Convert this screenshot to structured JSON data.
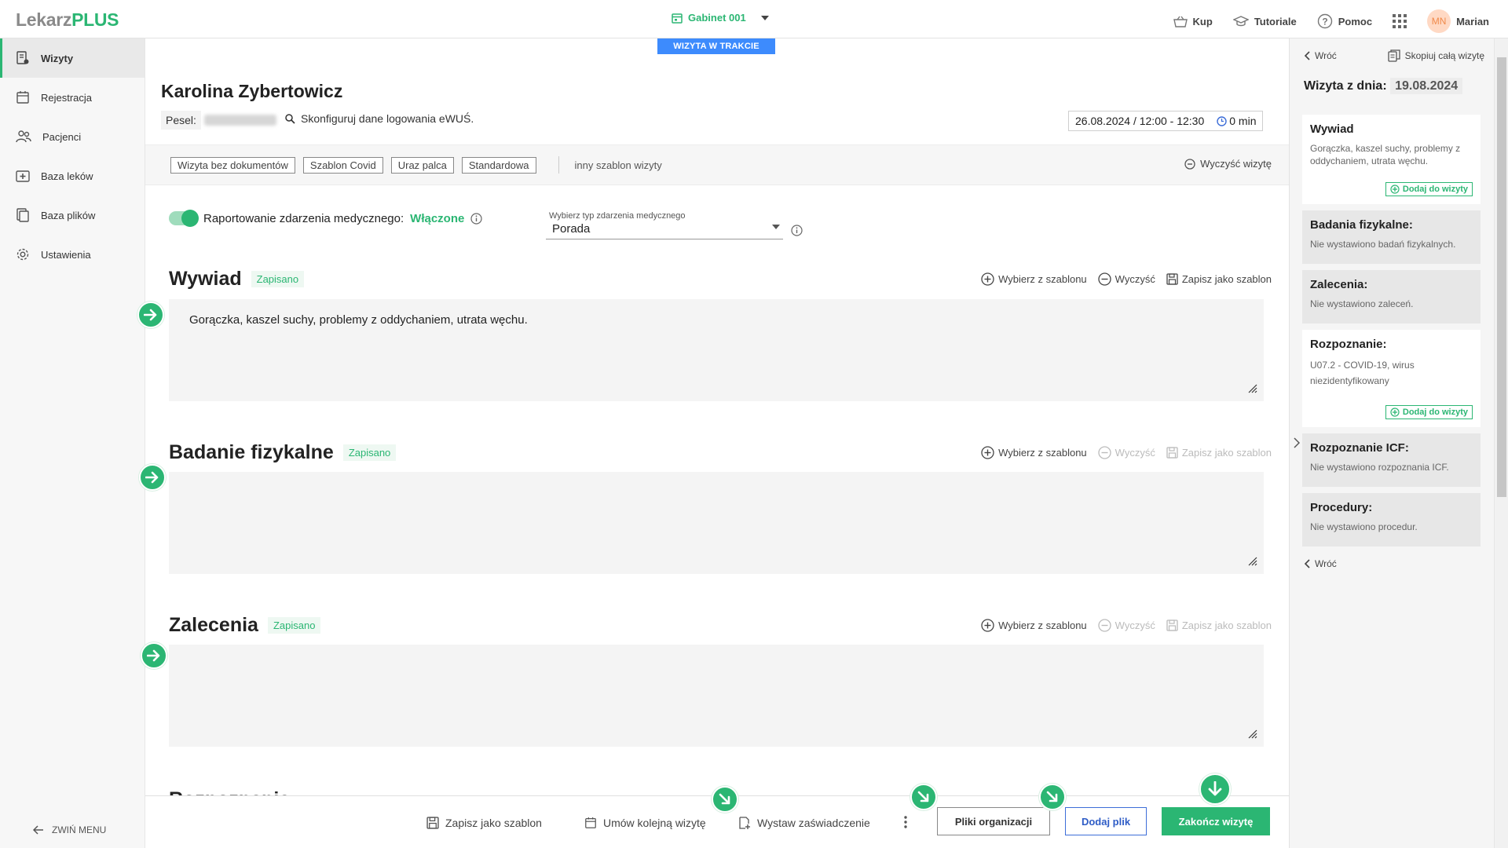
{
  "app": {
    "logo_part1": "Lekarz",
    "logo_part2": "PLUS",
    "cabinet": "Gabinet 001"
  },
  "topnav": {
    "buy": "Kup",
    "tutorials": "Tutoriale",
    "help": "Pomoc",
    "avatar_initials": "MN",
    "user": "Marian"
  },
  "sidebar": {
    "items": [
      {
        "label": "Wizyty",
        "icon": "visits-icon",
        "active": true
      },
      {
        "label": "Rejestracja",
        "icon": "calendar-icon"
      },
      {
        "label": "Pacjenci",
        "icon": "patients-icon"
      },
      {
        "label": "Baza leków",
        "icon": "medkit-icon"
      },
      {
        "label": "Baza plików",
        "icon": "file-icon"
      },
      {
        "label": "Ustawienia",
        "icon": "gear-icon"
      }
    ],
    "collapse": "ZWIŃ MENU"
  },
  "visit": {
    "status_badge": "WIZYTA W TRAKCIE",
    "patient_name": "Karolina Zybertowicz",
    "pesel_label": "Pesel:",
    "ewus_link": "Skonfiguruj dane logowania eWUŚ.",
    "date_range": "26.08.2024 / 12:00 - 12:30",
    "duration": "0 min",
    "templates": [
      "Wizyta bez dokumentów",
      "Szablon Covid",
      "Uraz palca",
      "Standardowa"
    ],
    "other_template": "inny szablon wizyty",
    "clear_visit": "Wyczyść wizytę",
    "reporting_label": "Raportowanie zdarzenia medycznego:",
    "reporting_state": "Włączone",
    "event_type_caption": "Wybierz typ zdarzenia medycznego",
    "event_type_value": "Porada"
  },
  "actions": {
    "from_template": "Wybierz z szablonu",
    "clear": "Wyczyść",
    "save_template": "Zapisz jako szablon"
  },
  "sections": [
    {
      "title": "Wywiad",
      "status": "Zapisano",
      "text": "Gorączka, kaszel suchy, problemy z oddychaniem, utrata węchu."
    },
    {
      "title": "Badanie fizykalne",
      "status": "Zapisano",
      "text": ""
    },
    {
      "title": "Zalecenia",
      "status": "Zapisano",
      "text": ""
    }
  ],
  "partial_section_title": "Rozpoznanie",
  "bottombar": {
    "save_template": "Zapisz jako szablon",
    "next_visit": "Umów kolejną wizytę",
    "certificate": "Wystaw zaświadczenie",
    "org_files": "Pliki organizacji",
    "add_file": "Dodaj plik",
    "finish": "Zakończ wizytę"
  },
  "right_panel": {
    "back": "Wróć",
    "copy_visit": "Skopiuj całą wizytę",
    "date_label": "Wizyta z dnia:",
    "date_value": "19.08.2024",
    "add_to_visit": "Dodaj do wizyty",
    "cards": [
      {
        "title": "Wywiad",
        "text": "Gorączka, kaszel suchy, problemy z oddychaniem, utrata węchu."
      },
      {
        "title": "Badania fizykalne:",
        "text": "Nie wystawiono badań fizykalnych."
      },
      {
        "title": "Zalecenia:",
        "text": "Nie wystawiono zaleceń."
      },
      {
        "title": "Rozpoznanie:",
        "text": "U07.2 - COVID-19, wirus niezidentyfikowany"
      },
      {
        "title": "Rozpoznanie ICF:",
        "text": "Nie wystawiono rozpoznania ICF."
      },
      {
        "title": "Procedury:",
        "text": "Nie wystawiono procedur."
      }
    ],
    "back_bottom": "Wróć"
  },
  "colors": {
    "brand_green": "#2bb673",
    "badge_blue": "#3d8bfd",
    "button_blue": "#2e5cc6"
  }
}
